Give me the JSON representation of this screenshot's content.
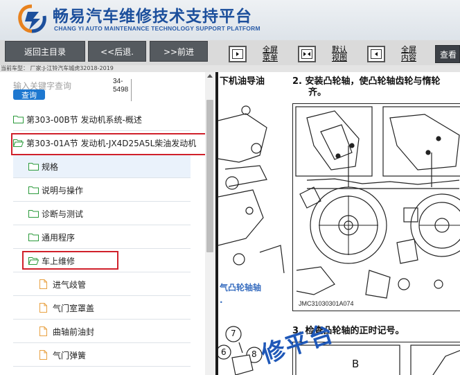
{
  "header": {
    "title": "畅易汽车维修技术支持平台",
    "subtitle": "CHANG YI AUTO MAINTENANCE TECHNOLOGY SUPPORT PLATFORM"
  },
  "toolbar": {
    "back_main": "返回主目录",
    "back": "<<后退.",
    "forward": ">>前进",
    "fullscreen_menu": [
      "全屏",
      "菜单"
    ],
    "default_view": [
      "默认",
      "视图"
    ],
    "fullscreen_content": [
      "全屏",
      "内容"
    ],
    "view": "查看"
  },
  "path": "当前车型：  厂家:J-江铃汽车城虎32018-2019",
  "search": {
    "placeholder": "输入关键字查询",
    "button": "查询",
    "count_top": "34-",
    "count_bottom": "5498"
  },
  "tree": [
    {
      "label": "第303-00B节 发动机系统-概述",
      "type": "folder"
    },
    {
      "label": "第303-01A节 发动机-JX4D25A5L柴油发动机",
      "type": "folder-open"
    },
    {
      "label": "规格",
      "type": "folder"
    },
    {
      "label": "说明与操作",
      "type": "folder"
    },
    {
      "label": "诊断与测试",
      "type": "folder"
    },
    {
      "label": "通用程序",
      "type": "folder"
    },
    {
      "label": "车上维修",
      "type": "folder-open"
    },
    {
      "label": "进气歧管",
      "type": "doc"
    },
    {
      "label": "气门室罩盖",
      "type": "doc"
    },
    {
      "label": "曲轴前油封",
      "type": "doc"
    },
    {
      "label": "气门弹簧",
      "type": "doc"
    }
  ],
  "content": {
    "left_heading": "下机油导油",
    "step2_line1": "2.  安装凸轮轴，使凸轮轴齿轮与惰轮",
    "step2_line2": "齐。",
    "left_caption": "气凸轮轴轴",
    "figure_code": "JMC31030301A074",
    "step3": "3.  检查凸轮轴的正时记号。",
    "callout_7": "7",
    "callout_6": "6",
    "callout_8": "8",
    "label_b": "B",
    "watermark": "修平台"
  }
}
